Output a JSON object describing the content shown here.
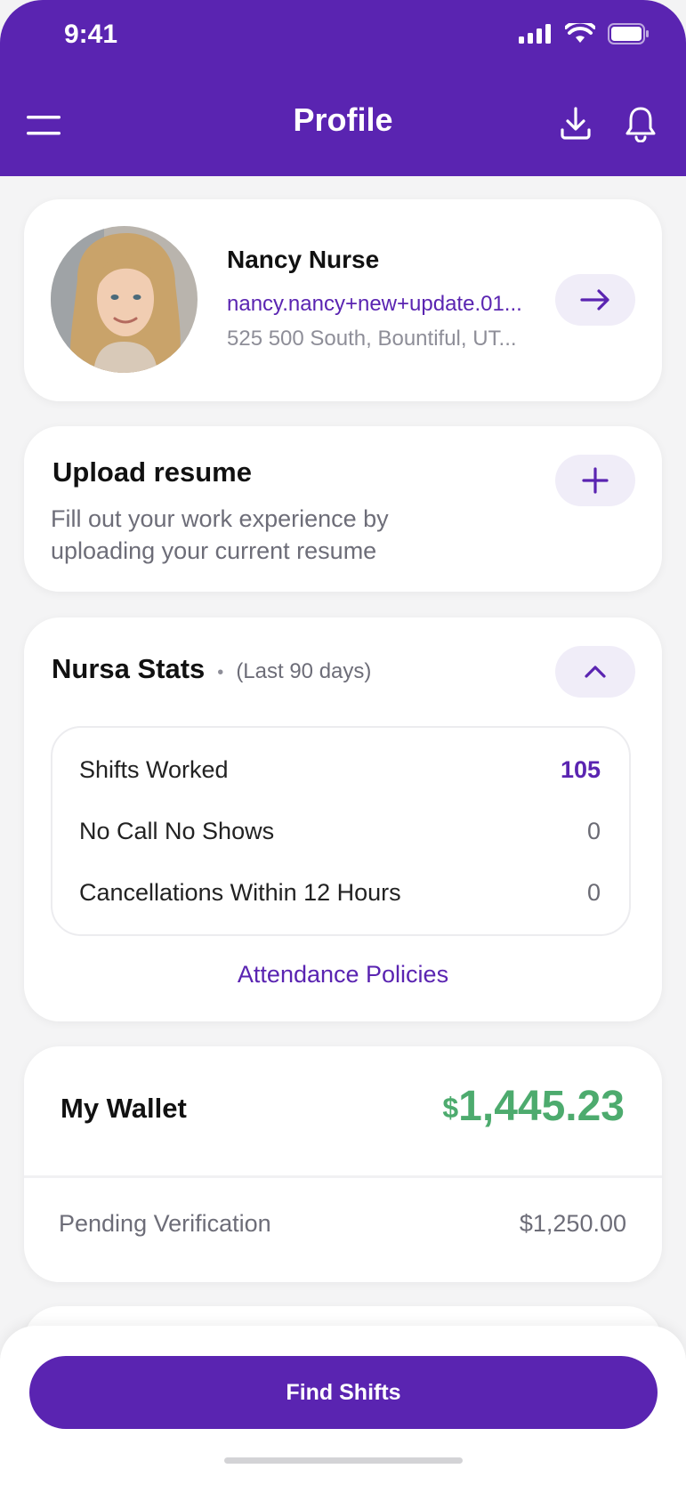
{
  "status_bar": {
    "time": "9:41"
  },
  "header": {
    "title": "Profile"
  },
  "profile": {
    "name": "Nancy Nurse",
    "email": "nancy.nancy+new+update.01...",
    "address": "525 500 South, Bountiful, UT..."
  },
  "resume": {
    "title": "Upload resume",
    "description_line1": "Fill out your work experience by",
    "description_line2": "uploading your current resume"
  },
  "stats": {
    "title": "Nursa Stats",
    "separator": "•",
    "period": "(Last 90 days)",
    "rows": [
      {
        "label": "Shifts Worked",
        "value": "105"
      },
      {
        "label": "No Call No Shows",
        "value": "0"
      },
      {
        "label": "Cancellations Within 12 Hours",
        "value": "0"
      }
    ],
    "link": "Attendance Policies"
  },
  "wallet": {
    "title": "My Wallet",
    "currency": "$",
    "amount": "1,445.23",
    "pending_label": "Pending Verification",
    "pending_value": "$1,250.00"
  },
  "footer": {
    "cta_label": "Find Shifts"
  },
  "colors": {
    "brand": "#5a24b1",
    "wallet_green": "#4dab6e",
    "background": "#f4f4f5"
  },
  "icons": {
    "menu": "menu-icon",
    "download": "download-icon",
    "bell": "bell-icon",
    "arrow": "arrow-right-icon",
    "plus": "plus-icon",
    "chevron": "chevron-up-icon"
  }
}
